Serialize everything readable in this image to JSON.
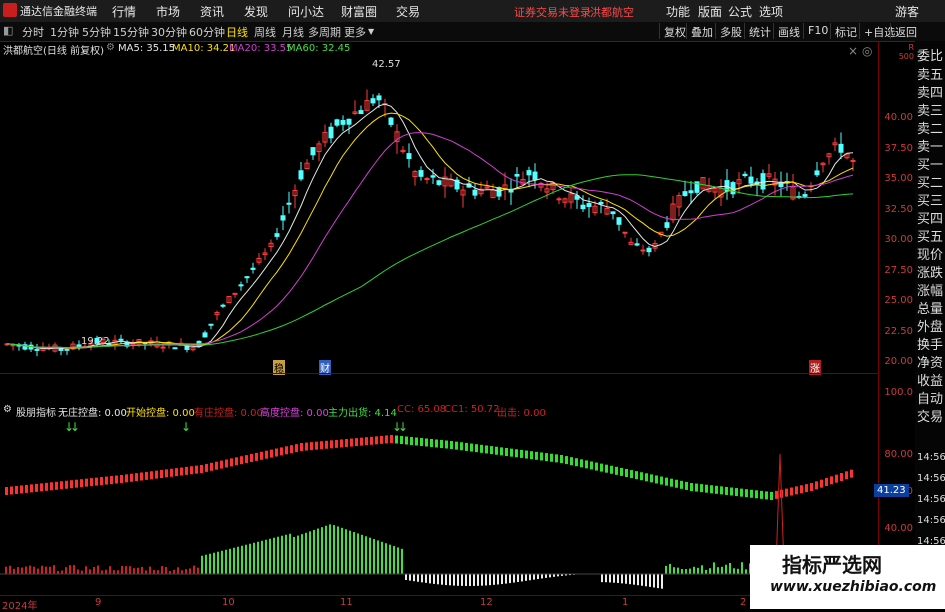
{
  "app": {
    "title": "通达信金融终端",
    "menu": [
      "行情",
      "市场",
      "资讯",
      "发现",
      "问小达",
      "财富圈",
      "交易"
    ],
    "notice": "证券交易未登录",
    "stock_short": "洪都航空",
    "right_menu": [
      "功能",
      "版面",
      "公式",
      "选项"
    ],
    "guest": "游客"
  },
  "periods": {
    "items": [
      "分时",
      "1分钟",
      "5分钟",
      "15分钟",
      "30分钟",
      "60分钟",
      "日线",
      "周线",
      "月线",
      "多周期",
      "更多"
    ],
    "active": "日线",
    "tools": [
      "复权",
      "叠加",
      "多股",
      "统计",
      "画线",
      "F10",
      "标记",
      "+自选",
      "返回"
    ]
  },
  "main": {
    "title": "洪都航空(日线 前复权)",
    "ma": {
      "ma5": "MA5: 35.15",
      "ma10": "MA10: 34.21",
      "ma20": "MA20: 33.55",
      "ma60": "MA60: 32.45"
    },
    "y_ticks": [
      "40.00",
      "37.50",
      "35.00",
      "32.50",
      "30.00",
      "27.50",
      "25.00",
      "22.50",
      "20.00"
    ],
    "high_label": "42.57",
    "low_label": "19.22",
    "markers": [
      "稳",
      "财",
      "涨"
    ],
    "axis_corner": [
      "R",
      "500"
    ]
  },
  "indicator": {
    "name": "股朋指标",
    "fields": [
      {
        "label": "无庄控盘: 0.00",
        "color": "#e6e6e6"
      },
      {
        "label": "开始控盘: 0.00",
        "color": "#ffe000"
      },
      {
        "label": "有庄控盘: 0.00",
        "color": "#d02020"
      },
      {
        "label": "高度控盘: 0.00",
        "color": "#e040e0"
      },
      {
        "label": "主力出货: 4.14",
        "color": "#40e040"
      },
      {
        "label": "CC: 65.08",
        "color": "#d02020"
      },
      {
        "label": "CC1: 50.72",
        "color": "#d02020"
      },
      {
        "label": "出击: 0.00",
        "color": "#d02020"
      }
    ],
    "y_ticks": [
      "100.0",
      "80.00",
      "60.00",
      "40.00"
    ],
    "current_value": "41.23",
    "time_labels": [
      "14:56",
      "14:56",
      "14:56",
      "14:56",
      "14:56",
      "14:56",
      "14:56"
    ]
  },
  "right_panel": [
    "委比",
    "卖五",
    "卖四",
    "卖三",
    "卖二",
    "卖一",
    "买一",
    "买二",
    "买三",
    "买四",
    "买五",
    "现价",
    "涨跌",
    "涨幅",
    "总量",
    "外盘",
    "换手",
    "净资",
    "收益",
    "自动",
    "交易"
  ],
  "dates": [
    "2024年",
    "9",
    "10",
    "11",
    "12",
    "1",
    "2"
  ],
  "watermark": {
    "cn": "指标严选网",
    "url": "www.xuezhibiao.com"
  }
}
